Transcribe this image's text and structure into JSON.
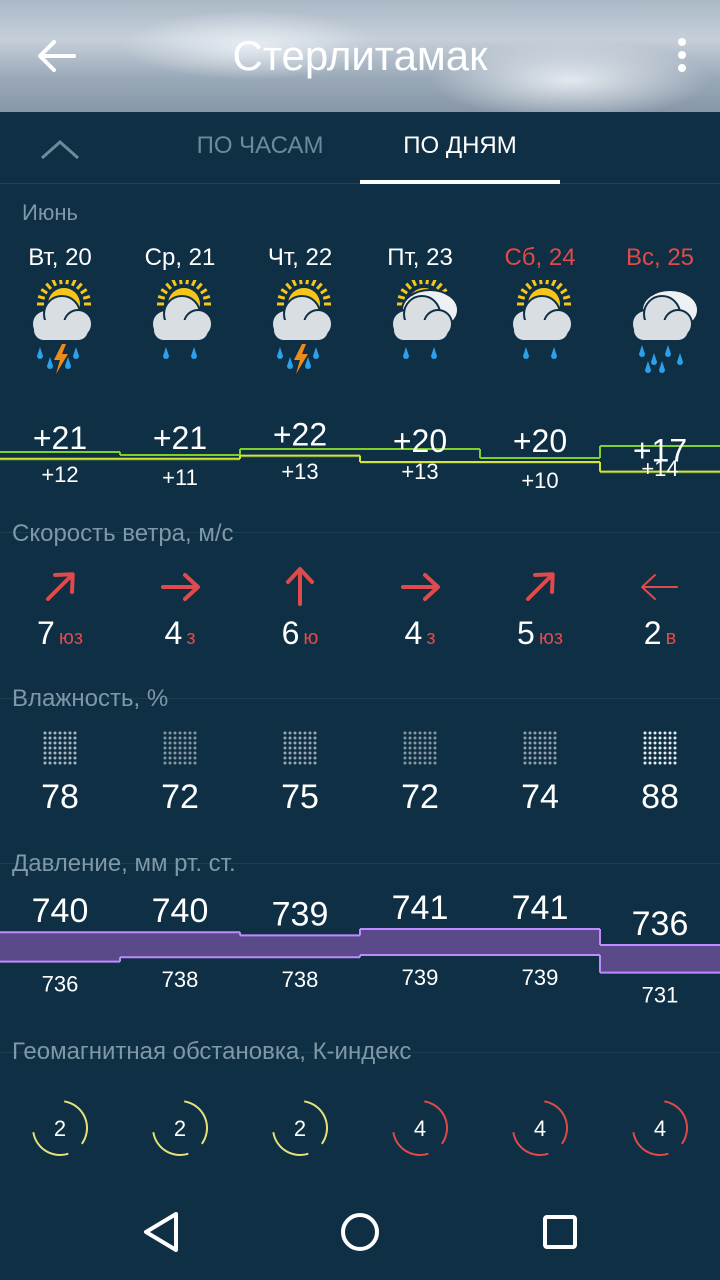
{
  "header": {
    "title": "Стерлитамак"
  },
  "tabs": [
    {
      "label": "ПО ЧАСАМ",
      "active": false
    },
    {
      "label": "ПО ДНЯМ",
      "active": true
    }
  ],
  "month": "Июнь",
  "days": [
    {
      "label": "Вт, 20",
      "weekend": false,
      "icon": "partly-cloudy-thunderstorm-icon",
      "sun": true,
      "lightning": true,
      "temp_hi": "+21",
      "temp_lo": "+12",
      "hi": 21,
      "lo": 12,
      "wind_speed": "7",
      "wind_dir": "юз",
      "wind_arrow": "northeast-arrow-icon",
      "humidity": "78",
      "pressure_hi": "740",
      "pressure_lo": "736",
      "p_hi": 740,
      "p_lo": 736,
      "kindex": "2"
    },
    {
      "label": "Ср, 21",
      "weekend": false,
      "icon": "partly-cloudy-rain-icon",
      "sun": true,
      "lightning": false,
      "temp_hi": "+21",
      "temp_lo": "+11",
      "hi": 21,
      "lo": 11,
      "wind_speed": "4",
      "wind_dir": "з",
      "wind_arrow": "east-arrow-icon",
      "humidity": "72",
      "pressure_hi": "740",
      "pressure_lo": "738",
      "p_hi": 740,
      "p_lo": 738,
      "kindex": "2"
    },
    {
      "label": "Чт, 22",
      "weekend": false,
      "icon": "partly-cloudy-thunderstorm-icon",
      "sun": true,
      "lightning": true,
      "temp_hi": "+22",
      "temp_lo": "+13",
      "hi": 22,
      "lo": 13,
      "wind_speed": "6",
      "wind_dir": "ю",
      "wind_arrow": "north-arrow-icon",
      "humidity": "75",
      "pressure_hi": "739",
      "pressure_lo": "738",
      "p_hi": 739,
      "p_lo": 738,
      "kindex": "2"
    },
    {
      "label": "Пт, 23",
      "weekend": false,
      "icon": "cloudy-rain-icon",
      "sun": true,
      "lightning": false,
      "temp_hi": "+20",
      "temp_lo": "+13",
      "hi": 20,
      "lo": 13,
      "wind_speed": "4",
      "wind_dir": "з",
      "wind_arrow": "east-arrow-icon",
      "humidity": "72",
      "pressure_hi": "741",
      "pressure_lo": "739",
      "p_hi": 741,
      "p_lo": 739,
      "kindex": "4"
    },
    {
      "label": "Сб, 24",
      "weekend": true,
      "icon": "partly-cloudy-rain-icon",
      "sun": true,
      "lightning": false,
      "temp_hi": "+20",
      "temp_lo": "+10",
      "hi": 20,
      "lo": 10,
      "wind_speed": "5",
      "wind_dir": "юз",
      "wind_arrow": "northeast-arrow-icon",
      "humidity": "74",
      "pressure_hi": "741",
      "pressure_lo": "739",
      "p_hi": 741,
      "p_lo": 739,
      "kindex": "4"
    },
    {
      "label": "Вс, 25",
      "weekend": true,
      "icon": "cloudy-heavy-rain-icon",
      "sun": false,
      "lightning": false,
      "temp_hi": "+17",
      "temp_lo": "+14",
      "hi": 17,
      "lo": 14,
      "wind_speed": "2",
      "wind_dir": "в",
      "wind_arrow": "west-arrow-icon",
      "humidity": "88",
      "pressure_hi": "736",
      "pressure_lo": "731",
      "p_hi": 736,
      "p_lo": 731,
      "kindex": "4"
    }
  ],
  "sections": {
    "wind": "Скорость ветра, м/с",
    "humidity": "Влажность, %",
    "pressure": "Давление, мм рт. ст.",
    "geomagnetic": "Геомагнитная обстановка, К-индекс"
  },
  "colors": {
    "background": "#0e2f44",
    "temp_fill": "#2d5a3a",
    "temp_line": "#d4e23a",
    "pressure_fill": "#5a4a8a",
    "pressure_line": "#c08aff",
    "accent_red": "#e04a4a",
    "kindex_low": "#e8e07a",
    "kindex_high": "#e04a4a"
  },
  "navbar": {
    "back": "nav-back-icon",
    "home": "nav-home-icon",
    "recents": "nav-recents-icon"
  }
}
